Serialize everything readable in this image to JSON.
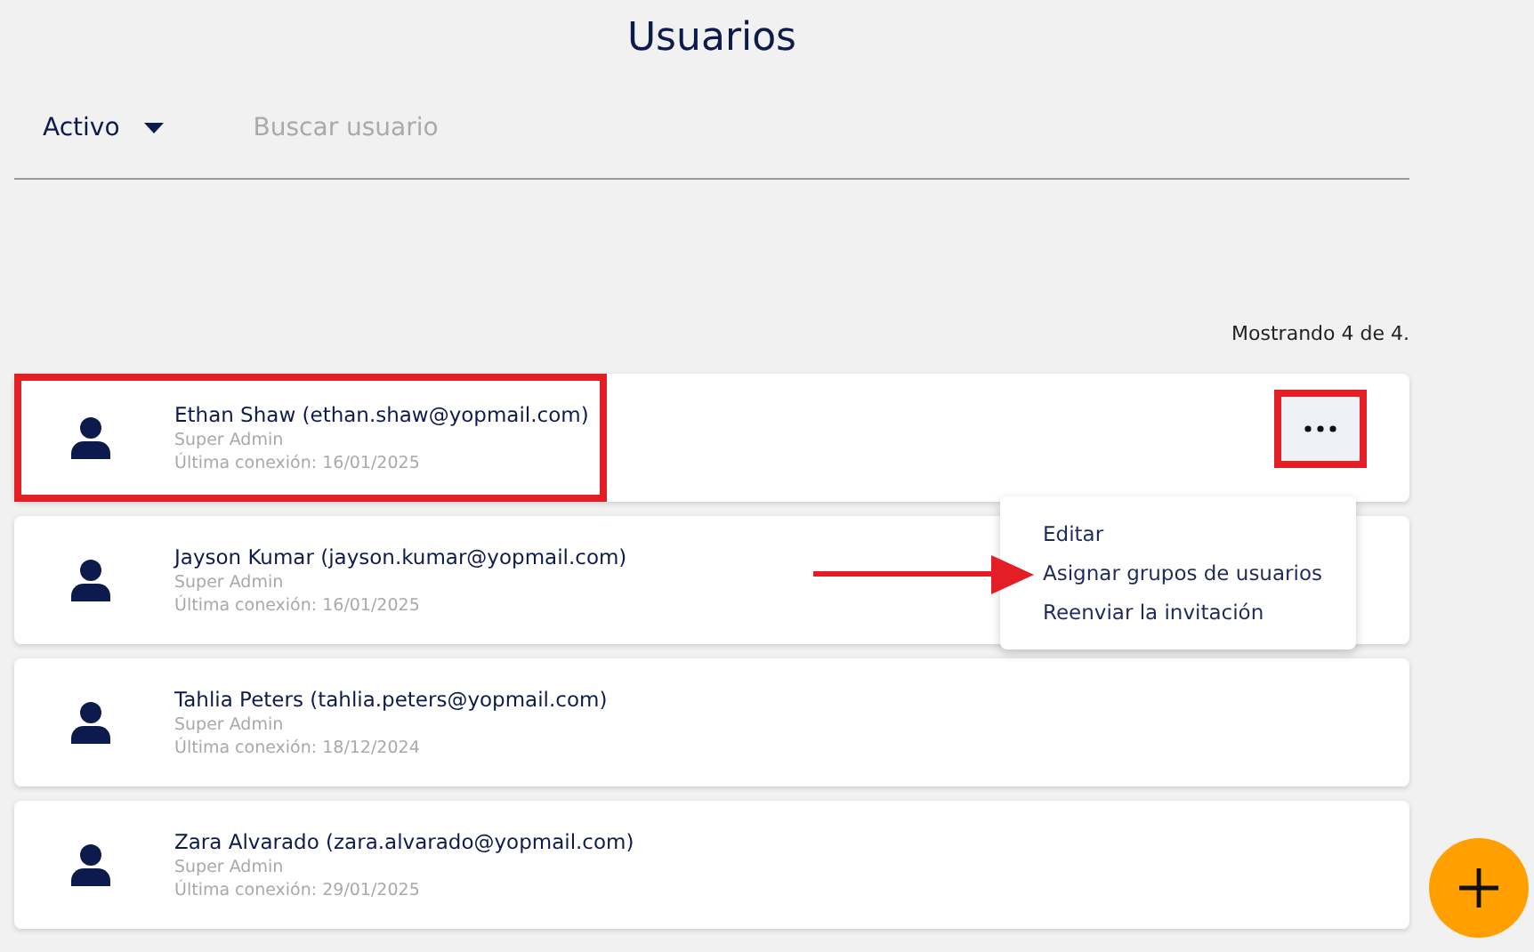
{
  "title": "Usuarios",
  "filter": {
    "value": "Activo",
    "expanded": false
  },
  "search": {
    "placeholder": "Buscar usuario"
  },
  "count": "Mostrando 4 de 4.",
  "users": [
    {
      "name": "Ethan Shaw (ethan.shaw@yopmail.com)",
      "role": "Super Admin",
      "last_login": "Última conexión: 16/01/2025",
      "highlighted": true,
      "menu_open": true
    },
    {
      "name": "Jayson Kumar (jayson.kumar@yopmail.com)",
      "role": "Super Admin",
      "last_login": "Última conexión: 16/01/2025",
      "highlighted": false,
      "menu_open": false
    },
    {
      "name": "Tahlia Peters (tahlia.peters@yopmail.com)",
      "role": "Super Admin",
      "last_login": "Última conexión: 18/12/2024",
      "highlighted": false,
      "menu_open": false
    },
    {
      "name": "Zara Alvarado (zara.alvarado@yopmail.com)",
      "role": "Super Admin",
      "last_login": "Última conexión: 29/01/2025",
      "highlighted": false,
      "menu_open": false
    }
  ],
  "menu": {
    "items": [
      {
        "label": "Editar",
        "pointed": false
      },
      {
        "label": "Asignar grupos de usuarios",
        "pointed": true
      },
      {
        "label": "Reenviar la invitación",
        "pointed": false
      }
    ]
  },
  "add_button": {
    "shown": true
  }
}
